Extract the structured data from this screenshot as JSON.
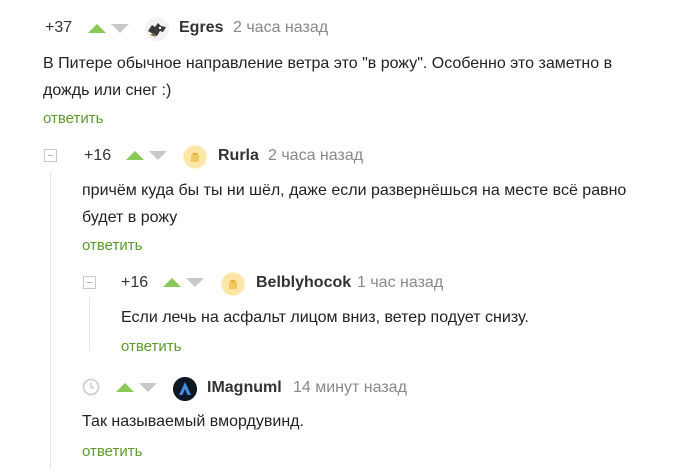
{
  "comments": [
    {
      "rating": "+37",
      "author": "Egres",
      "time": "2 часа назад",
      "text_line1": "В Питере обычное направление ветра это \"в рожу\". Особенно это заметно в",
      "text_line2": "дождь или снег :)",
      "reply": "ответить"
    },
    {
      "rating": "+16",
      "author": "Rurla",
      "time": "2 часа назад",
      "text_line1": "причём куда бы ты ни шёл, даже если развернёшься на месте всё равно",
      "text_line2": "будет в рожу",
      "reply": "ответить"
    },
    {
      "rating": "+16",
      "author": "Belblyhocok",
      "time": "1 час назад",
      "text_line1": "Если лечь на асфальт лицом вниз, ветер подует снизу.",
      "reply": "ответить"
    },
    {
      "author": "IMagnuml",
      "time": "14 минут назад",
      "text_line1": "Так называемый вмордувинд.",
      "reply": "ответить"
    }
  ],
  "colors": {
    "upvote": "#8ac858",
    "downvote": "#c8c8c8",
    "reply_link": "#5c9a2b",
    "muted": "#888888"
  },
  "icons": {
    "collapse": "collapse-icon",
    "clock": "clock-icon",
    "upvote": "upvote-arrow-icon",
    "downvote": "downvote-arrow-icon"
  }
}
